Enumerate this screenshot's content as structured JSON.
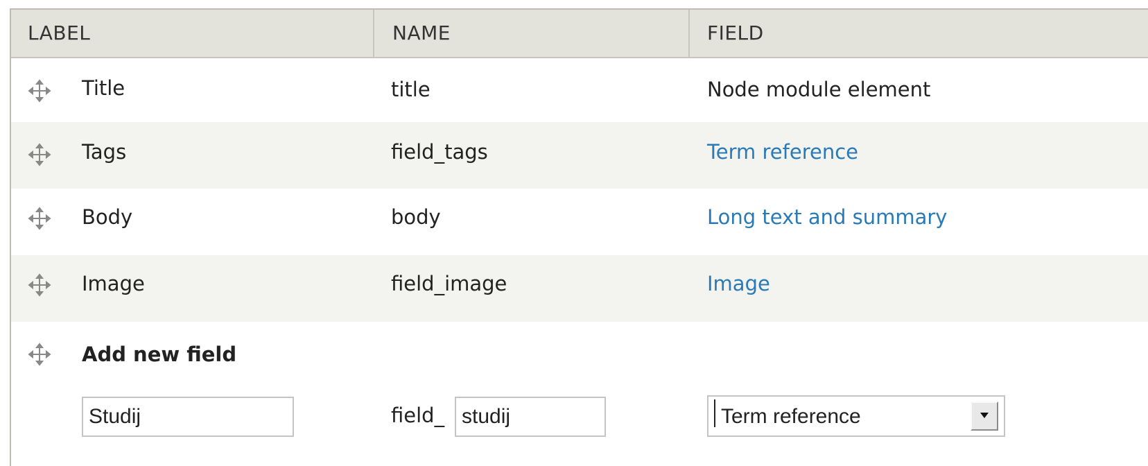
{
  "table": {
    "headers": {
      "label": "LABEL",
      "name": "NAME",
      "field": "FIELD"
    },
    "rows": [
      {
        "label": "Title",
        "name": "title",
        "field": "Node module element",
        "field_is_link": false
      },
      {
        "label": "Tags",
        "name": "field_tags",
        "field": "Term reference",
        "field_is_link": true
      },
      {
        "label": "Body",
        "name": "body",
        "field": "Long text and summary",
        "field_is_link": true
      },
      {
        "label": "Image",
        "name": "field_image",
        "field": "Image",
        "field_is_link": true
      }
    ],
    "add_new": {
      "heading": "Add new field",
      "label_value": "Studij",
      "name_prefix": "field_",
      "name_value": "studij",
      "field_type_selected": "Term reference"
    }
  },
  "colors": {
    "link": "#2a7ab8",
    "header_bg": "#e3e3dc",
    "stripe_bg": "#f3f3ef"
  },
  "icons": {
    "drag_handle": "drag-handle-icon",
    "dropdown": "chevron-down-icon"
  }
}
